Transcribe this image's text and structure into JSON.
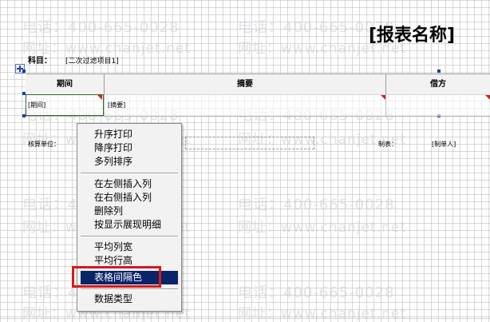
{
  "report": {
    "title": "[报表名称]",
    "subject_label": "科目：",
    "subject_value": "[二次过滤项目1]"
  },
  "table": {
    "headers": [
      "期间",
      "摘要",
      "借方"
    ],
    "row": [
      "[期间]",
      "[摘要]"
    ]
  },
  "footer": {
    "unit_label": "核算单位：",
    "maker_label": "制表：",
    "maker_value": "[制单人]"
  },
  "watermark": {
    "phone": "电话：400-665-0028",
    "site": "网址：www.chanjet.net"
  },
  "context_menu": {
    "items": [
      "升序打印",
      "降序打印",
      "多列排序",
      "在左侧插入列",
      "在右侧插入列",
      "删除列",
      "按显示展现明细",
      "平均列宽",
      "平均行高",
      "表格间隔色",
      "数据类型"
    ],
    "highlighted": "表格间隔色"
  },
  "colors": {
    "highlight": "#0a246a",
    "annotation_box": "#d61a1a",
    "selection": "#1b3fa3",
    "cell_marker": "#d62020"
  },
  "icons": [
    "add-row-icon"
  ]
}
